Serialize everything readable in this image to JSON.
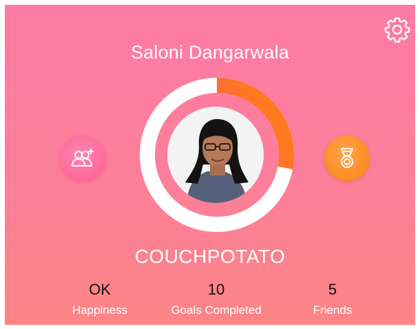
{
  "profile": {
    "name": "Saloni Dangarwala",
    "rank": "COUCHPOTATO",
    "progress": 0.28
  },
  "icons": {
    "settings": "gear-icon",
    "friends": "add-friends-icon",
    "medal": "medal-icon"
  },
  "stats": [
    {
      "value": "OK",
      "label": "Happiness"
    },
    {
      "value": "10",
      "label": "Goals Completed"
    },
    {
      "value": "5",
      "label": "Friends"
    }
  ],
  "colors": {
    "progress_start": "#ff3f86",
    "progress_end": "#ff7a1e",
    "friends_button": "#ff6a9c",
    "medal_button": "#ff8a1f"
  }
}
